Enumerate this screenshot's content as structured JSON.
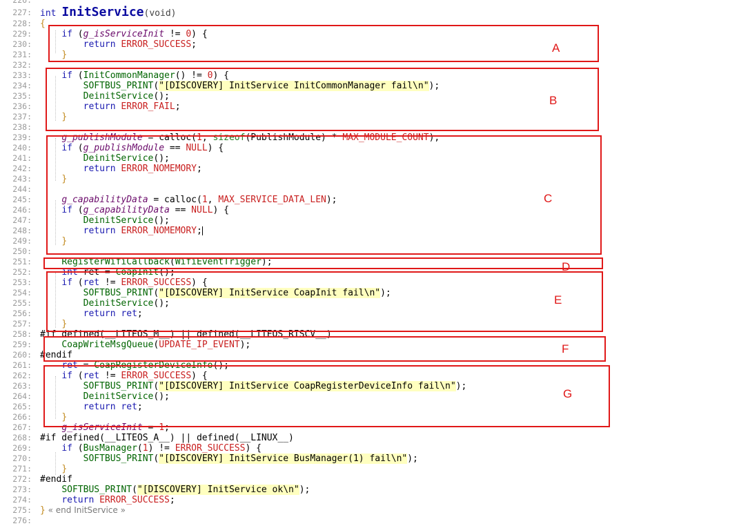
{
  "editor": {
    "lines": [
      {
        "n": "226:",
        "parts": []
      },
      {
        "n": "227:",
        "parts": [
          [
            "kw",
            "int "
          ],
          [
            "title",
            "InitService"
          ],
          [
            "pn",
            "(void)"
          ]
        ]
      },
      {
        "n": "228:",
        "parts": [
          [
            "fold",
            "{"
          ]
        ]
      },
      {
        "n": "229:",
        "parts": [
          [
            "",
            "    "
          ],
          [
            "kw",
            "if"
          ],
          [
            "",
            " ("
          ],
          [
            "gv",
            "g_isServiceInit"
          ],
          [
            "",
            " != "
          ],
          [
            "num",
            "0"
          ],
          [
            "",
            ") {"
          ]
        ]
      },
      {
        "n": "230:",
        "parts": [
          [
            "",
            "        "
          ],
          [
            "kw",
            "return "
          ],
          [
            "mac",
            "ERROR_SUCCESS"
          ],
          [
            "",
            ";"
          ]
        ]
      },
      {
        "n": "231:",
        "parts": [
          [
            "",
            "    "
          ],
          [
            "fold",
            "}"
          ]
        ]
      },
      {
        "n": "232:",
        "parts": []
      },
      {
        "n": "233:",
        "parts": [
          [
            "",
            "    "
          ],
          [
            "kw",
            "if"
          ],
          [
            "",
            " ("
          ],
          [
            "fn",
            "InitCommonManager"
          ],
          [
            "",
            "() != "
          ],
          [
            "num",
            "0"
          ],
          [
            "",
            ") {"
          ]
        ]
      },
      {
        "n": "234:",
        "parts": [
          [
            "",
            "        "
          ],
          [
            "fn",
            "SOFTBUS_PRINT"
          ],
          [
            "",
            "("
          ],
          [
            "str",
            "\"[DISCOVERY] InitService InitCommonManager fail\\n\""
          ],
          [
            "",
            ");"
          ]
        ]
      },
      {
        "n": "235:",
        "parts": [
          [
            "",
            "        "
          ],
          [
            "fn",
            "DeinitService"
          ],
          [
            "",
            "();"
          ]
        ]
      },
      {
        "n": "236:",
        "parts": [
          [
            "",
            "        "
          ],
          [
            "kw",
            "return "
          ],
          [
            "mac",
            "ERROR_FAIL"
          ],
          [
            "",
            ";"
          ]
        ]
      },
      {
        "n": "237:",
        "parts": [
          [
            "",
            "    "
          ],
          [
            "fold",
            "}"
          ]
        ]
      },
      {
        "n": "238:",
        "parts": []
      },
      {
        "n": "239:",
        "parts": [
          [
            "",
            "    "
          ],
          [
            "gv",
            "g_publishModule"
          ],
          [
            "",
            " = calloc("
          ],
          [
            "num",
            "1"
          ],
          [
            "",
            ", "
          ],
          [
            "tp",
            "sizeof"
          ],
          [
            "",
            "(PublishModule) * "
          ],
          [
            "mac",
            "MAX_MODULE_COUNT"
          ],
          [
            "",
            ");"
          ]
        ]
      },
      {
        "n": "240:",
        "parts": [
          [
            "",
            "    "
          ],
          [
            "kw",
            "if"
          ],
          [
            "",
            " ("
          ],
          [
            "gv",
            "g_publishModule"
          ],
          [
            "",
            " == "
          ],
          [
            "mac",
            "NULL"
          ],
          [
            "",
            ") {"
          ]
        ]
      },
      {
        "n": "241:",
        "parts": [
          [
            "",
            "        "
          ],
          [
            "fn",
            "DeinitService"
          ],
          [
            "",
            "();"
          ]
        ]
      },
      {
        "n": "242:",
        "parts": [
          [
            "",
            "        "
          ],
          [
            "kw",
            "return "
          ],
          [
            "mac",
            "ERROR_NOMEMORY"
          ],
          [
            "",
            ";"
          ]
        ]
      },
      {
        "n": "243:",
        "parts": [
          [
            "",
            "    "
          ],
          [
            "fold",
            "}"
          ]
        ]
      },
      {
        "n": "244:",
        "parts": []
      },
      {
        "n": "245:",
        "parts": [
          [
            "",
            "    "
          ],
          [
            "gv",
            "g_capabilityData"
          ],
          [
            "",
            " = calloc("
          ],
          [
            "num",
            "1"
          ],
          [
            "",
            ", "
          ],
          [
            "mac",
            "MAX_SERVICE_DATA_LEN"
          ],
          [
            "",
            ");"
          ]
        ]
      },
      {
        "n": "246:",
        "parts": [
          [
            "",
            "    "
          ],
          [
            "kw",
            "if"
          ],
          [
            "",
            " ("
          ],
          [
            "gv",
            "g_capabilityData"
          ],
          [
            "",
            " == "
          ],
          [
            "mac",
            "NULL"
          ],
          [
            "",
            ") {"
          ]
        ]
      },
      {
        "n": "247:",
        "parts": [
          [
            "",
            "        "
          ],
          [
            "fn",
            "DeinitService"
          ],
          [
            "",
            "();"
          ]
        ]
      },
      {
        "n": "248:",
        "parts": [
          [
            "",
            "        "
          ],
          [
            "kw",
            "return "
          ],
          [
            "mac",
            "ERROR_NOMEMORY"
          ],
          [
            "",
            ";"
          ],
          [
            "caret",
            ""
          ]
        ]
      },
      {
        "n": "249:",
        "parts": [
          [
            "",
            "    "
          ],
          [
            "fold",
            "}"
          ]
        ]
      },
      {
        "n": "250:",
        "parts": []
      },
      {
        "n": "251:",
        "parts": [
          [
            "",
            "    "
          ],
          [
            "fn",
            "RegisterWifiCallback"
          ],
          [
            "",
            "("
          ],
          [
            "fn",
            "WifiEventTrigger"
          ],
          [
            "",
            ");"
          ]
        ]
      },
      {
        "n": "252:",
        "parts": [
          [
            "",
            "    "
          ],
          [
            "kw",
            "int"
          ],
          [
            "",
            " ret = "
          ],
          [
            "fn",
            "CoapInit"
          ],
          [
            "",
            "();"
          ]
        ]
      },
      {
        "n": "253:",
        "parts": [
          [
            "",
            "    "
          ],
          [
            "kw",
            "if"
          ],
          [
            "",
            " ("
          ],
          [
            "kw",
            "ret"
          ],
          [
            "",
            " != "
          ],
          [
            "mac",
            "ERROR_SUCCESS"
          ],
          [
            "",
            ") {"
          ]
        ]
      },
      {
        "n": "254:",
        "parts": [
          [
            "",
            "        "
          ],
          [
            "fn",
            "SOFTBUS_PRINT"
          ],
          [
            "",
            "("
          ],
          [
            "str",
            "\"[DISCOVERY] InitService CoapInit fail\\n\""
          ],
          [
            "",
            ");"
          ]
        ]
      },
      {
        "n": "255:",
        "parts": [
          [
            "",
            "        "
          ],
          [
            "fn",
            "DeinitService"
          ],
          [
            "",
            "();"
          ]
        ]
      },
      {
        "n": "256:",
        "parts": [
          [
            "",
            "        "
          ],
          [
            "kw",
            "return "
          ],
          [
            "kw",
            "ret"
          ],
          [
            "",
            ";"
          ]
        ]
      },
      {
        "n": "257:",
        "parts": [
          [
            "",
            "    "
          ],
          [
            "fold",
            "}"
          ]
        ]
      },
      {
        "n": "258:",
        "parts": [
          [
            "",
            "#if defined(__LITEOS_M__) || defined(__LITEOS_RISCV__)"
          ]
        ]
      },
      {
        "n": "259:",
        "parts": [
          [
            "",
            "    "
          ],
          [
            "fn",
            "CoapWriteMsgQueue"
          ],
          [
            "",
            "("
          ],
          [
            "mac",
            "UPDATE_IP_EVENT"
          ],
          [
            "",
            ");"
          ]
        ]
      },
      {
        "n": "260:",
        "parts": [
          [
            "",
            "#endif"
          ]
        ]
      },
      {
        "n": "261:",
        "parts": [
          [
            "",
            "    "
          ],
          [
            "kw",
            "ret"
          ],
          [
            "",
            " = "
          ],
          [
            "fn",
            "CoapRegisterDeviceInfo"
          ],
          [
            "",
            "();"
          ]
        ]
      },
      {
        "n": "262:",
        "parts": [
          [
            "",
            "    "
          ],
          [
            "kw",
            "if"
          ],
          [
            "",
            " ("
          ],
          [
            "kw",
            "ret"
          ],
          [
            "",
            " != "
          ],
          [
            "mac",
            "ERROR_SUCCESS"
          ],
          [
            "",
            ") {"
          ]
        ]
      },
      {
        "n": "263:",
        "parts": [
          [
            "",
            "        "
          ],
          [
            "fn",
            "SOFTBUS_PRINT"
          ],
          [
            "",
            "("
          ],
          [
            "str",
            "\"[DISCOVERY] InitService CoapRegisterDeviceInfo fail\\n\""
          ],
          [
            "",
            ");"
          ]
        ]
      },
      {
        "n": "264:",
        "parts": [
          [
            "",
            "        "
          ],
          [
            "fn",
            "DeinitService"
          ],
          [
            "",
            "();"
          ]
        ]
      },
      {
        "n": "265:",
        "parts": [
          [
            "",
            "        "
          ],
          [
            "kw",
            "return "
          ],
          [
            "kw",
            "ret"
          ],
          [
            "",
            ";"
          ]
        ]
      },
      {
        "n": "266:",
        "parts": [
          [
            "",
            "    "
          ],
          [
            "fold",
            "}"
          ]
        ]
      },
      {
        "n": "267:",
        "parts": [
          [
            "",
            "    "
          ],
          [
            "gv",
            "g_isServiceInit"
          ],
          [
            "",
            " = "
          ],
          [
            "num",
            "1"
          ],
          [
            "",
            ";"
          ]
        ]
      },
      {
        "n": "268:",
        "parts": [
          [
            "",
            "#if defined(__LITEOS_A__) || defined(__LINUX__)"
          ]
        ]
      },
      {
        "n": "269:",
        "parts": [
          [
            "",
            "    "
          ],
          [
            "kw",
            "if"
          ],
          [
            "",
            " ("
          ],
          [
            "fn",
            "BusManager"
          ],
          [
            "",
            "("
          ],
          [
            "num",
            "1"
          ],
          [
            "",
            ") != "
          ],
          [
            "mac",
            "ERROR_SUCCESS"
          ],
          [
            "",
            ") {"
          ]
        ]
      },
      {
        "n": "270:",
        "parts": [
          [
            "",
            "        "
          ],
          [
            "fn",
            "SOFTBUS_PRINT"
          ],
          [
            "",
            "("
          ],
          [
            "str",
            "\"[DISCOVERY] InitService BusManager(1) fail\\n\""
          ],
          [
            "",
            ");"
          ]
        ]
      },
      {
        "n": "271:",
        "parts": [
          [
            "",
            "    "
          ],
          [
            "fold",
            "}"
          ]
        ]
      },
      {
        "n": "272:",
        "parts": [
          [
            "",
            "#endif"
          ]
        ]
      },
      {
        "n": "273:",
        "parts": [
          [
            "",
            "    "
          ],
          [
            "fn",
            "SOFTBUS_PRINT"
          ],
          [
            "",
            "("
          ],
          [
            "str",
            "\"[DISCOVERY] InitService ok\\n\""
          ],
          [
            "",
            ");"
          ]
        ]
      },
      {
        "n": "274:",
        "parts": [
          [
            "",
            "    "
          ],
          [
            "kw",
            "return "
          ],
          [
            "mac",
            "ERROR_SUCCESS"
          ],
          [
            "",
            ";"
          ]
        ]
      },
      {
        "n": "275:",
        "parts": [
          [
            "fold",
            "}"
          ],
          [
            "cm",
            " « end InitService »"
          ]
        ]
      },
      {
        "n": "276:",
        "parts": []
      }
    ]
  },
  "annotations": [
    {
      "label": "A"
    },
    {
      "label": "B"
    },
    {
      "label": "C"
    },
    {
      "label": "D"
    },
    {
      "label": "E"
    },
    {
      "label": "F"
    },
    {
      "label": "G"
    }
  ],
  "colors": {
    "annotation": "#e01818",
    "keyword": "#1a1ab0",
    "function": "#006400",
    "macro": "#c81e1e",
    "string_bg": "#ffffbf"
  }
}
